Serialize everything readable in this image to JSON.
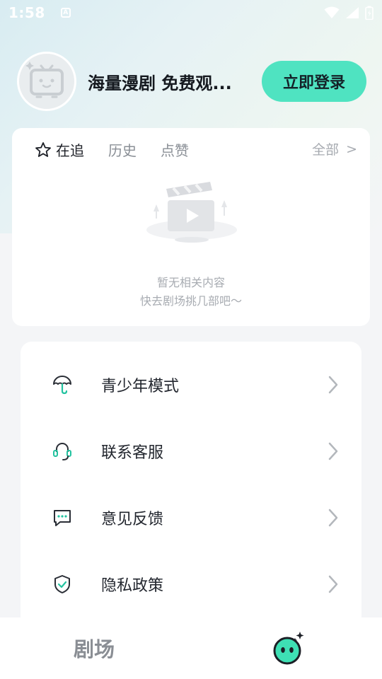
{
  "status_bar": {
    "time": "1:58",
    "notification_badge": "A",
    "icons": [
      "wifi-icon",
      "signal-icon",
      "battery-icon"
    ]
  },
  "profile": {
    "avatar_icon": "tv-robot-avatar-icon",
    "slogan": "海量漫剧 免费观...",
    "login_label": "立即登录"
  },
  "watch_card": {
    "tabs": [
      {
        "label": "在追",
        "icon": "star-icon",
        "active": true
      },
      {
        "label": "历史",
        "active": false
      },
      {
        "label": "点赞",
        "active": false
      }
    ],
    "all_label": "全部",
    "all_arrow": ">",
    "empty_icon": "clapperboard-play-icon",
    "empty_line1": "暂无相关内容",
    "empty_line2": "快去剧场挑几部吧～"
  },
  "menu": {
    "items": [
      {
        "label": "青少年模式",
        "icon": "umbrella-icon"
      },
      {
        "label": "联系客服",
        "icon": "headset-icon"
      },
      {
        "label": "意见反馈",
        "icon": "message-dots-icon"
      },
      {
        "label": "隐私政策",
        "icon": "shield-check-icon"
      }
    ]
  },
  "bottom_nav": {
    "theater_label": "剧场",
    "me_icon": "mascot-face-icon"
  },
  "colors": {
    "accent": "#4fe3c1",
    "icon_accent": "#23c3a0",
    "text_primary": "#1e2330",
    "text_secondary": "#8a8f96"
  }
}
